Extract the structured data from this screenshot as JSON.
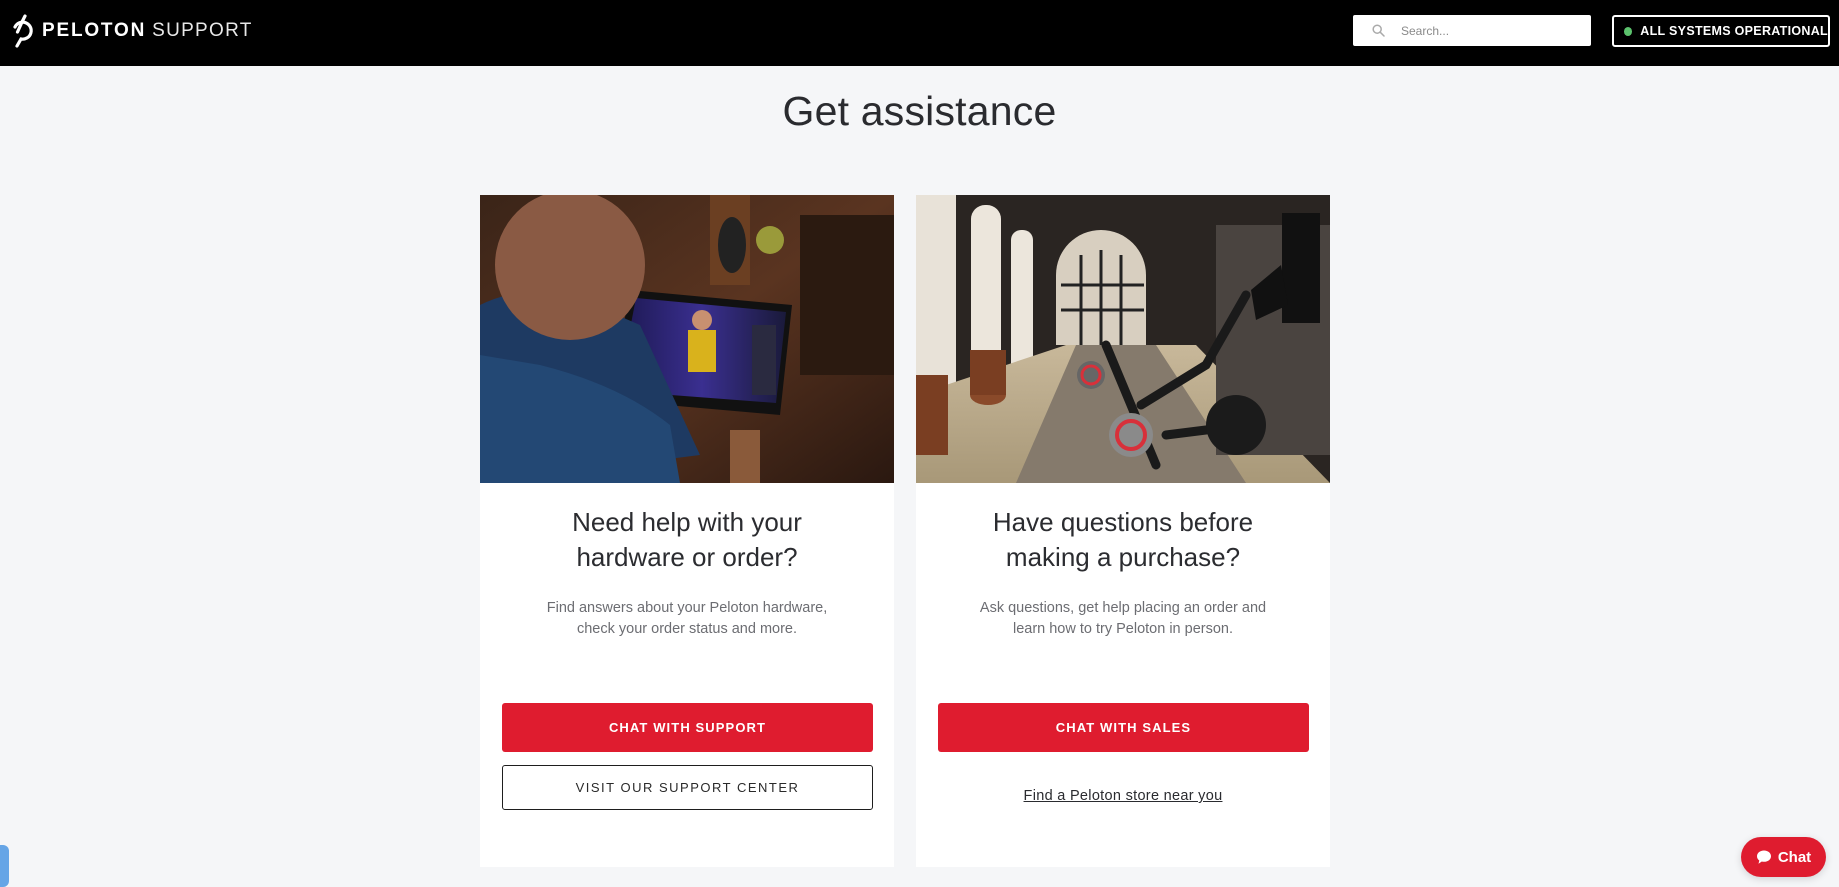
{
  "header": {
    "brand": "PELOTON",
    "section": "SUPPORT",
    "search_placeholder": "Search...",
    "search_value": "",
    "status_label": "ALL SYSTEMS OPERATIONAL",
    "status_color": "#5cc26d"
  },
  "main": {
    "title": "Get assistance",
    "cards": [
      {
        "image_alt": "Rider using a Peloton Bike with a class on screen",
        "heading_line1": "Need help with your",
        "heading_line2": "hardware or order?",
        "description_line1": "Find answers about your Peloton hardware,",
        "description_line2": "check your order status and more.",
        "primary_button": "CHAT WITH SUPPORT",
        "secondary_button": "VISIT OUR SUPPORT CENTER"
      },
      {
        "image_alt": "Row of Peloton bikes in a showroom",
        "heading_line1": "Have questions before",
        "heading_line2": "making a purchase?",
        "description_line1": "Ask questions, get help placing an order and",
        "description_line2": "learn how to try Peloton in person.",
        "primary_button": "CHAT WITH SALES",
        "link": "Find a Peloton store near you"
      }
    ]
  },
  "chat_widget": {
    "label": "Chat",
    "icon": "speech-bubble-icon"
  },
  "colors": {
    "accent": "#df1c2f",
    "header_bg": "#000000",
    "page_bg": "#f5f6f8"
  }
}
